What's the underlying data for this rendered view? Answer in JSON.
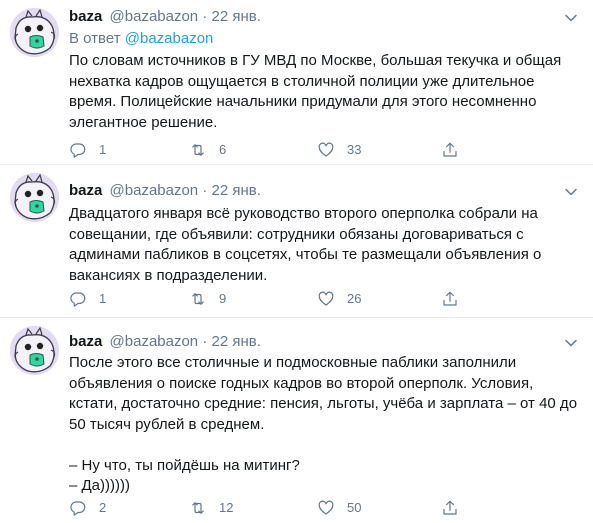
{
  "tweets": [
    {
      "name": "baza",
      "handle": "@bazabazon",
      "dot": "·",
      "date": "22 янв.",
      "reply_prefix": "В ответ",
      "reply_to": "@bazabazon",
      "text": "По словам источников в ГУ МВД по Москве, большая текучка и общая\nнехватка кадров ощущается в столичной полиции уже длительное\nвремя. Полицейские начальники придумали для этого несомненно\nэлегантное решение.",
      "replies": "1",
      "retweets": "6",
      "likes": "33"
    },
    {
      "name": "baza",
      "handle": "@bazabazon",
      "dot": "·",
      "date": "22 янв.",
      "text": "Двадцатого января всё руководство второго оперполка собрали на\nсовещании, где объявили: сотрудники обязаны договариваться с\nадминами пабликов в соцсетях, чтобы те размещали объявления о\nвакансиях в подразделении.",
      "replies": "1",
      "retweets": "9",
      "likes": "26"
    },
    {
      "name": "baza",
      "handle": "@bazabazon",
      "dot": "·",
      "date": "22 янв.",
      "text": "После этого все столичные и подмосковные паблики заполнили\nобъявления о поиске годных кадров во второй оперполк. Условия,\nкстати, достаточно средние: пенсия, льготы, учёба и зарплата – от 40 до\n50 тысяч рублей в среднем.\n\n– Ну что, ты пойдёшь на митинг?\n– Да))))))",
      "replies": "2",
      "retweets": "12",
      "likes": "50"
    }
  ],
  "icons": {
    "avatar": "cartoon-creature-avatar-icon",
    "caret": "chevron-down-icon",
    "reply": "reply-bubble-icon",
    "retweet": "retweet-icon",
    "like": "heart-icon",
    "share": "share-icon"
  },
  "colors": {
    "link": "#1da1f2",
    "secondary": "#657786",
    "text": "#14171a",
    "divider": "#e6ecf0",
    "thread": "#ccd6dd"
  }
}
